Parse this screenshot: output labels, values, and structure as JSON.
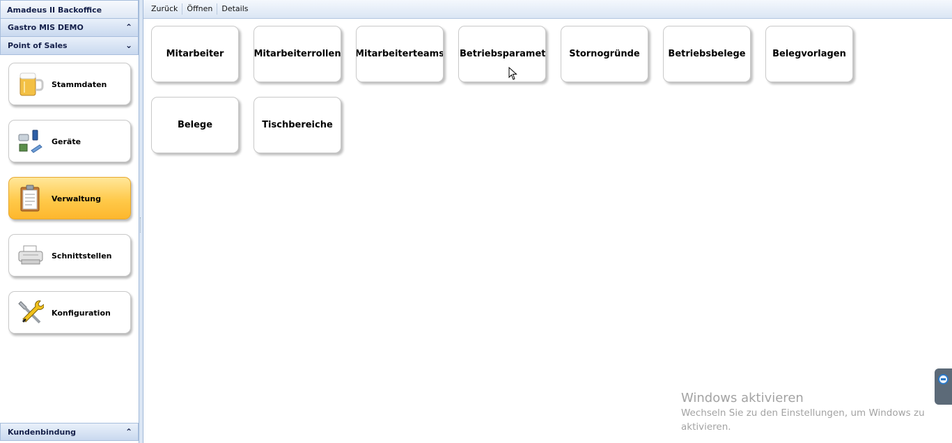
{
  "app": {
    "title": "Amadeus II Backoffice"
  },
  "sidebar": {
    "groups": [
      {
        "label": "Gastro MIS DEMO",
        "chevron": "chevron-up-icon"
      },
      {
        "label": "Point of Sales",
        "chevron": "chevron-down-icon"
      }
    ],
    "items": [
      {
        "label": "Stammdaten",
        "icon": "beer-mug-icon",
        "active": false
      },
      {
        "label": "Geräte",
        "icon": "devices-icon",
        "active": false
      },
      {
        "label": "Verwaltung",
        "icon": "clipboard-icon",
        "active": true
      },
      {
        "label": "Schnittstellen",
        "icon": "printer-icon",
        "active": false
      },
      {
        "label": "Konfiguration",
        "icon": "tools-icon",
        "active": false
      }
    ],
    "bottom_group": {
      "label": "Kundenbindung",
      "chevron": "chevron-up-icon"
    }
  },
  "toolbar": {
    "back_label": "Zurück",
    "open_label": "Öffnen",
    "details_label": "Details"
  },
  "tiles": [
    {
      "label": "Mitarbeiter"
    },
    {
      "label": "Mitarbeiterrollen"
    },
    {
      "label": "Mitarbeiterteams"
    },
    {
      "label": "Betriebsparameter"
    },
    {
      "label": "Stornogründe"
    },
    {
      "label": "Betriebsbelege"
    },
    {
      "label": "Belegvorlagen"
    },
    {
      "label": "Belege"
    },
    {
      "label": "Tischbereiche"
    }
  ],
  "watermark": {
    "title": "Windows aktivieren",
    "subtitle": "Wechseln Sie zu den Einstellungen, um Windows zu aktivieren."
  },
  "colors": {
    "active_tile": "#ffc94a",
    "header_bg": "#dbe6f4",
    "remote_handle": "#5c6a78"
  }
}
